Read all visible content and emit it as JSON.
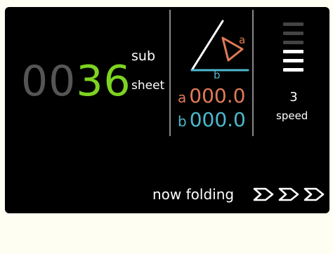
{
  "counter": {
    "leading_zeros": "00",
    "value": "36"
  },
  "units": {
    "sub": "sub",
    "sheet": "sheet"
  },
  "fold_geometry": {
    "a_symbol_label": "a",
    "b_symbol_label": "b",
    "a_key": "a",
    "a_value": "000.0",
    "b_key": "b",
    "b_value": "000.0"
  },
  "speed": {
    "level": 3,
    "max_level": 6,
    "value_text": "3",
    "label": "speed"
  },
  "status": {
    "text": "now folding",
    "chevron_count": 3
  },
  "colors": {
    "counter_active": "#7dd321",
    "counter_lead": "#555555",
    "accent_a": "#e07b55",
    "accent_b": "#4db8cc",
    "bar_on": "#ffffff",
    "bar_off": "#444444"
  },
  "icons": {
    "triangle": "fold-triangle-icon",
    "chevron": "chevron-right-icon"
  }
}
